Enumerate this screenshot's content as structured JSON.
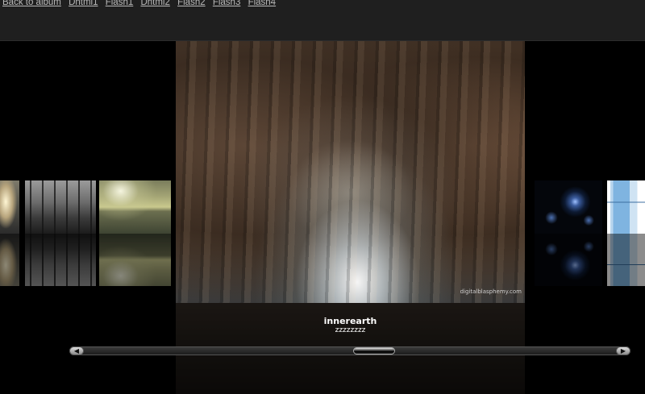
{
  "nav": {
    "links": [
      "Back to album",
      "Dhtml1",
      "Flash1",
      "Dhtml2",
      "Flash2",
      "Flash3",
      "Flash4"
    ]
  },
  "current": {
    "title": "innerearth",
    "description": "zzzzzzzz",
    "credit": "digitalblasphemy.com"
  },
  "scroll": {
    "left_arrow": "◀",
    "right_arrow": "▶"
  },
  "thumbnails": [
    {
      "name": "sky-thumbnail",
      "icon": "sunset-scene"
    },
    {
      "name": "forest-thumbnail",
      "icon": "forest-scene"
    },
    {
      "name": "lake-thumbnail",
      "icon": "lake-scene"
    },
    {
      "name": "space-thumbnail",
      "icon": "space-scene"
    },
    {
      "name": "fridge-thumbnail",
      "icon": "fridge-scene"
    }
  ],
  "colors": {
    "background": "#000000",
    "topbar": "#1f1f1f",
    "link": "#b9b9b9",
    "caption_text": "#ffffff"
  }
}
